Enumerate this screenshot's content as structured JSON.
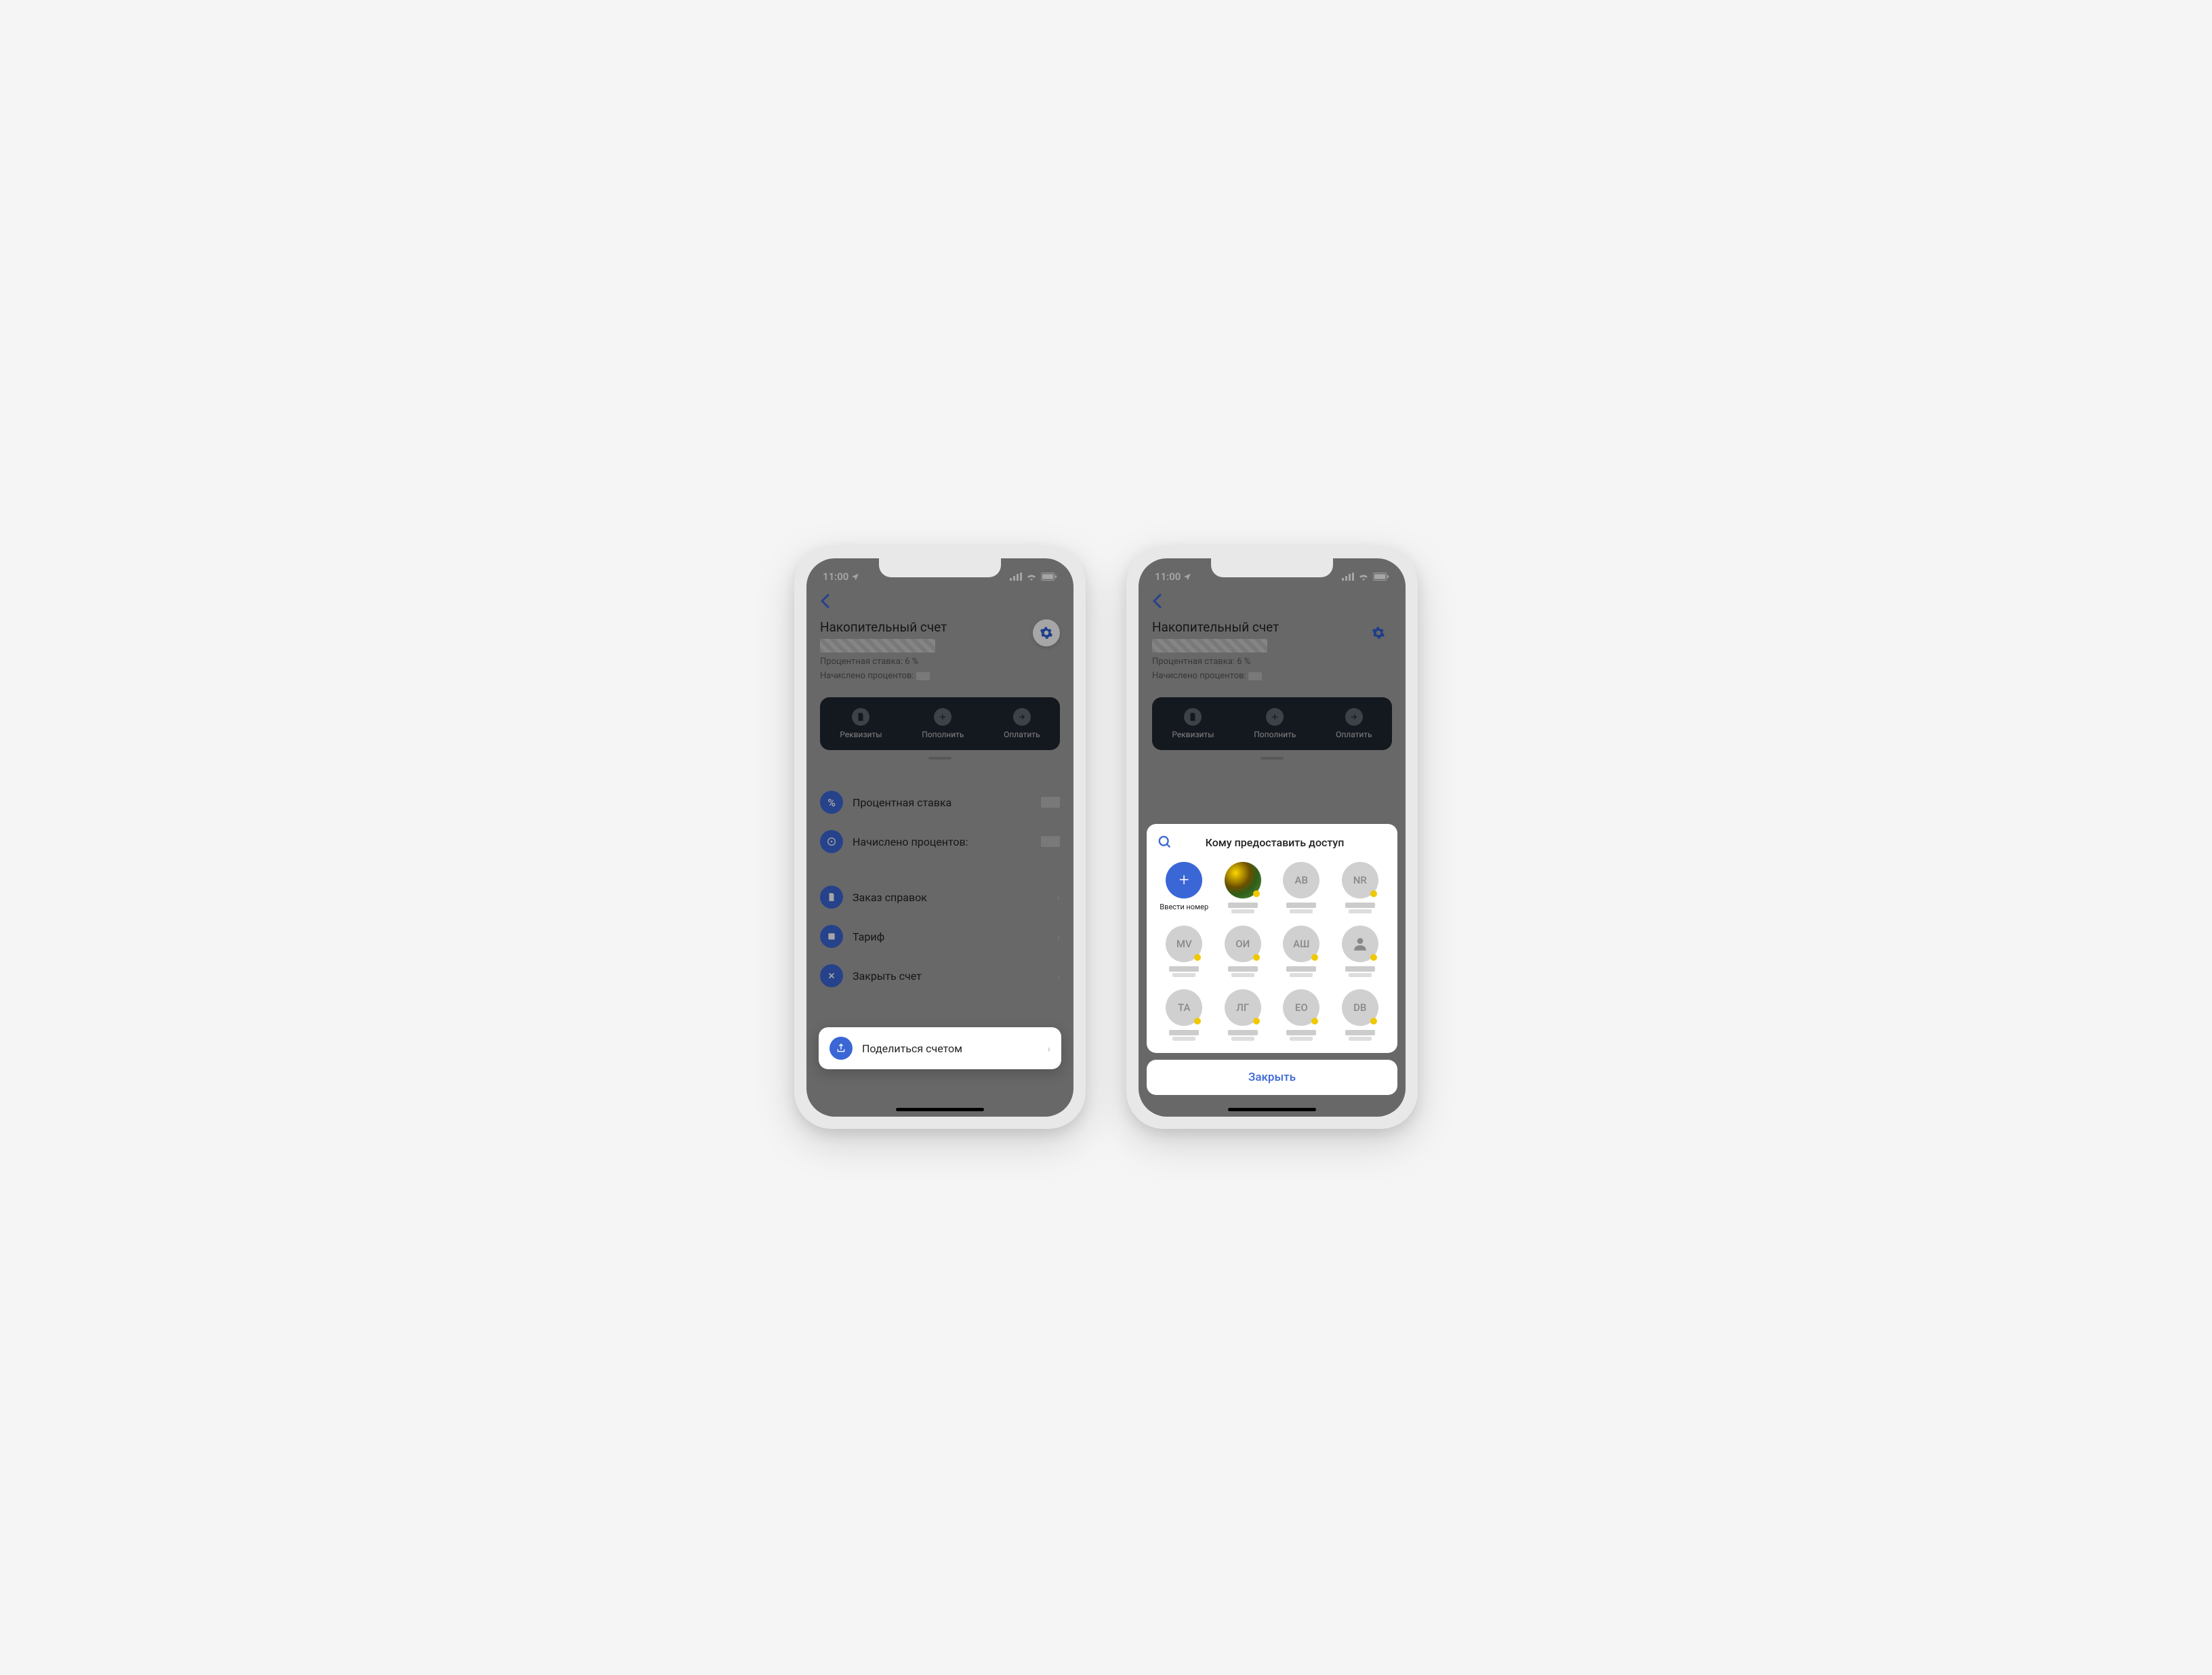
{
  "status": {
    "time": "11:00"
  },
  "account": {
    "title": "Накопительный счет",
    "rate_line": "Процентная ставка: 6 %",
    "accrued_line": "Начислено процентов:"
  },
  "actions": {
    "details": "Реквизиты",
    "topup": "Пополнить",
    "pay": "Оплатить"
  },
  "rows": {
    "rate": "Процентная ставка",
    "accrued": "Начислено процентов:",
    "order": "Заказ справок",
    "tariff": "Тариф",
    "close": "Закрыть счет"
  },
  "share_row": "Поделиться счетом",
  "sheet": {
    "title": "Кому предоставить доступ",
    "add_label": "Ввести номер",
    "close_btn": "Закрыть",
    "contacts": [
      {
        "initials": "",
        "photo": true
      },
      {
        "initials": "АВ"
      },
      {
        "initials": "NR"
      },
      {
        "initials": "MV"
      },
      {
        "initials": "ОИ"
      },
      {
        "initials": "АШ"
      },
      {
        "initials": "",
        "icon": true
      },
      {
        "initials": "ТА"
      },
      {
        "initials": "ЛГ"
      },
      {
        "initials": "ЕО"
      },
      {
        "initials": "DB"
      }
    ]
  }
}
